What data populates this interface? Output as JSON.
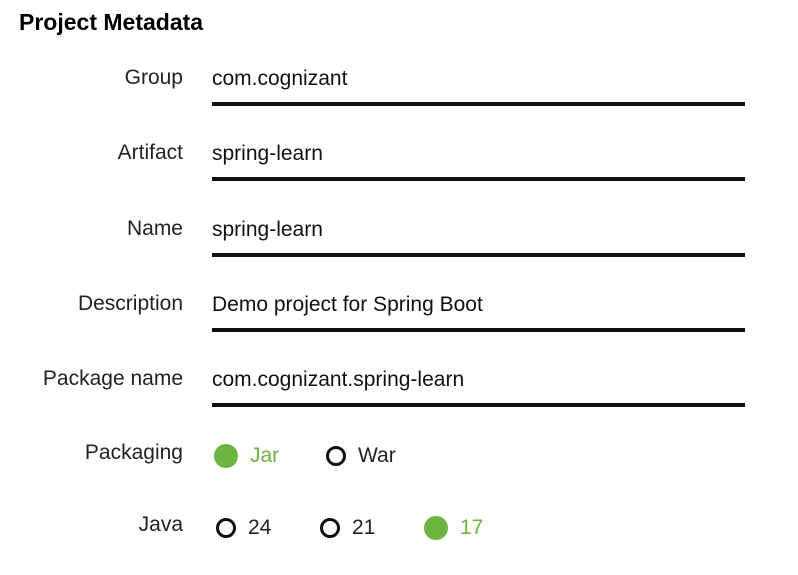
{
  "section": {
    "title": "Project Metadata"
  },
  "fields": {
    "group": {
      "label": "Group",
      "value": "com.cognizant"
    },
    "artifact": {
      "label": "Artifact",
      "value": "spring-learn"
    },
    "name": {
      "label": "Name",
      "value": "spring-learn"
    },
    "description": {
      "label": "Description",
      "value": "Demo project for Spring Boot"
    },
    "package_name": {
      "label": "Package name",
      "value": "com.cognizant.spring-learn"
    }
  },
  "packaging": {
    "label": "Packaging",
    "options": [
      {
        "label": "Jar",
        "selected": true
      },
      {
        "label": "War",
        "selected": false
      }
    ]
  },
  "java": {
    "label": "Java",
    "options": [
      {
        "label": "24",
        "selected": false
      },
      {
        "label": "21",
        "selected": false
      },
      {
        "label": "17",
        "selected": true
      }
    ]
  },
  "colors": {
    "accent": "#6db33f",
    "text": "#111111"
  }
}
